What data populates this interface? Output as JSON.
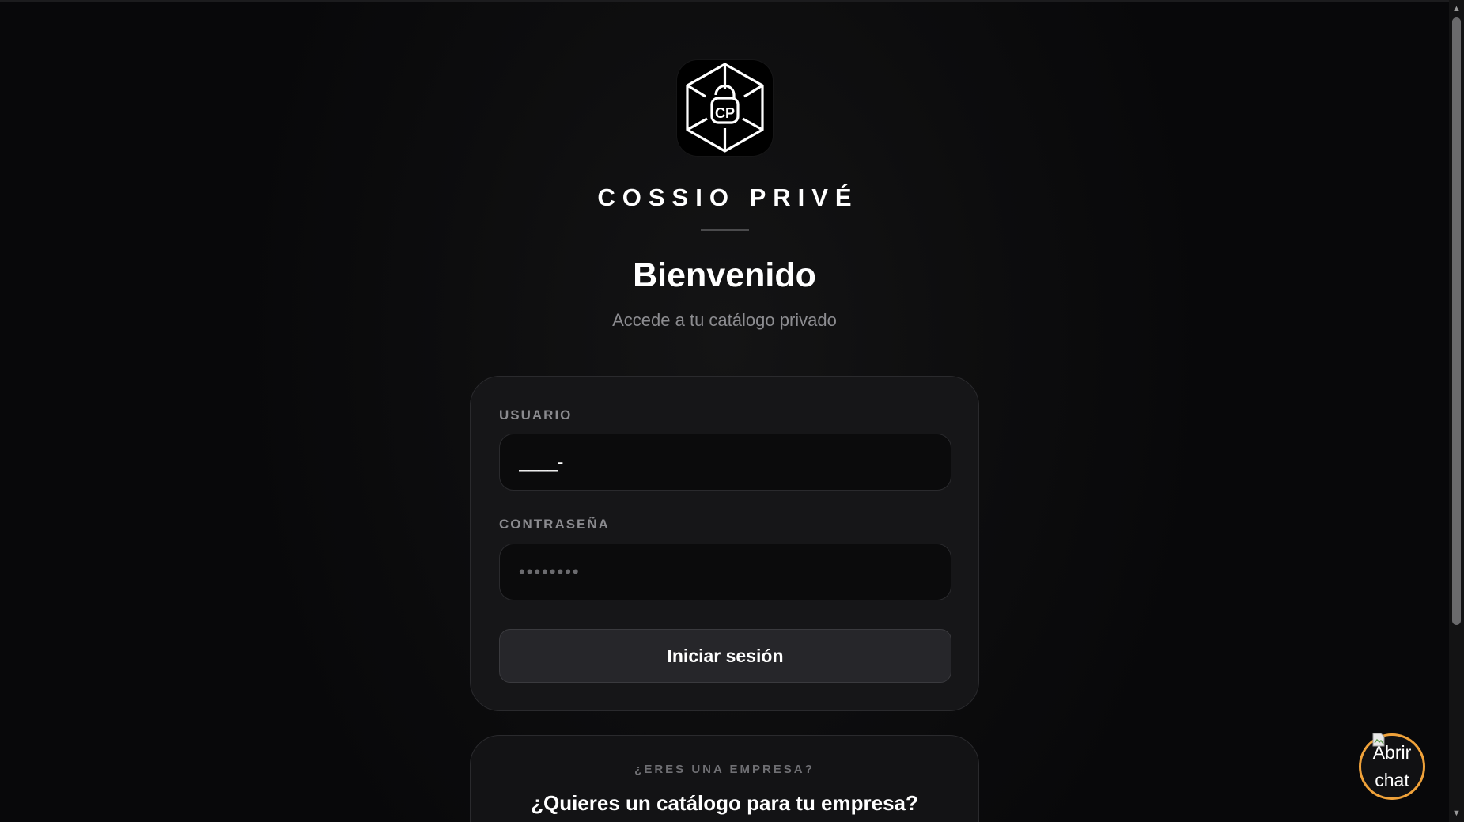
{
  "brand": {
    "logo_icon": "cube-lock-cp-logo-icon",
    "logo_text": "CP",
    "name": "COSSIO PRIVÉ"
  },
  "welcome": {
    "title": "Bienvenido",
    "subtitle": "Accede a tu catálogo privado"
  },
  "login_form": {
    "username_label": "USUARIO",
    "username_value": "____-",
    "password_label": "CONTRASEÑA",
    "password_value": "••••••••",
    "submit_label": "Iniciar sesión"
  },
  "business_card": {
    "eyebrow": "¿ERES UNA EMPRESA?",
    "title": "¿Quieres un catálogo para tu empresa?"
  },
  "chat_widget": {
    "label": "Abrir chat",
    "icon": "broken-image-icon",
    "accent_color": "#f0a23a"
  },
  "colors": {
    "background": "#0a0a0b",
    "card": "#161618",
    "input": "#0b0b0c",
    "button": "#26262a",
    "text": "#ffffff",
    "muted": "#8c8c90"
  }
}
